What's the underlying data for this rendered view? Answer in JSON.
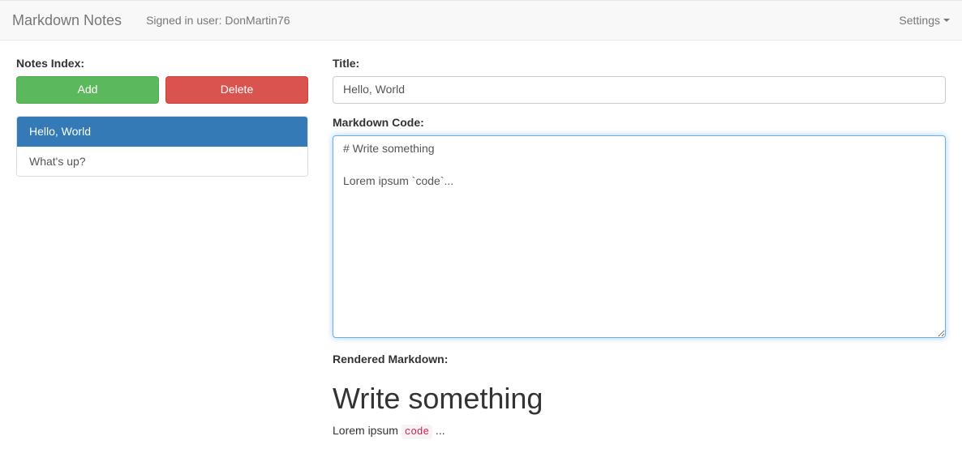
{
  "navbar": {
    "brand": "Markdown Notes",
    "signed_in_prefix": "Signed in user: ",
    "signed_in_user": "DonMartin76",
    "settings_label": "Settings"
  },
  "sidebar": {
    "index_label": "Notes Index:",
    "add_label": "Add",
    "delete_label": "Delete",
    "notes": [
      {
        "title": "Hello, World",
        "active": true
      },
      {
        "title": "What's up?",
        "active": false
      }
    ]
  },
  "editor": {
    "title_label": "Title:",
    "title_value": "Hello, World",
    "markdown_label": "Markdown Code:",
    "markdown_value": "# Write something\n\nLorem ipsum `code`...",
    "rendered_label": "Rendered Markdown:",
    "rendered_heading": "Write something",
    "rendered_text_before": "Lorem ipsum ",
    "rendered_code": "code",
    "rendered_text_after": " ..."
  }
}
